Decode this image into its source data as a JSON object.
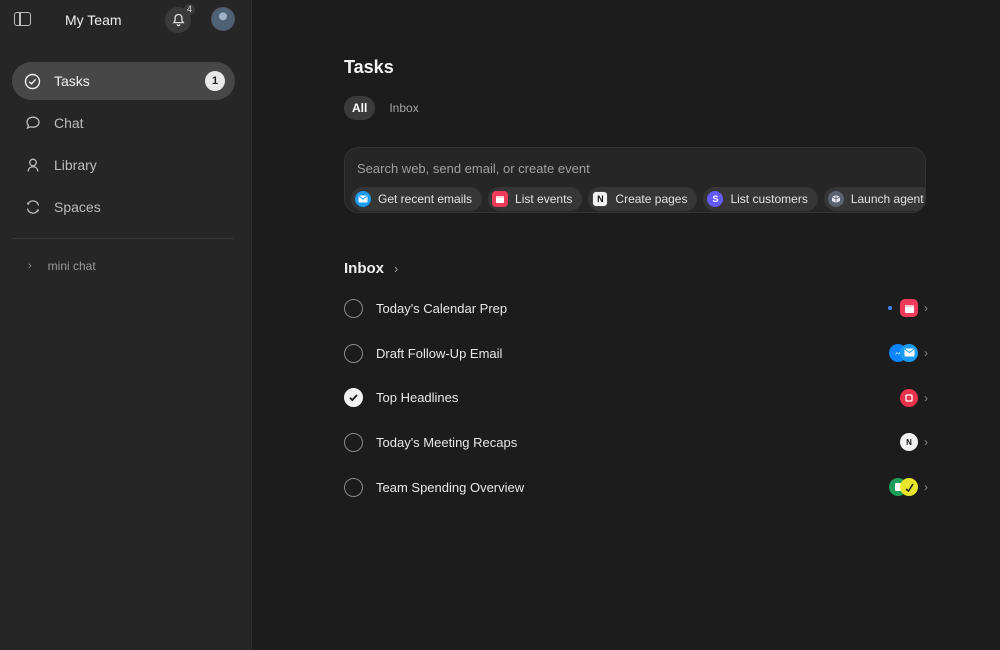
{
  "sidebar": {
    "team_name": "My Team",
    "notifications": "4",
    "nav": [
      {
        "label": "Tasks",
        "icon": "check-circle-icon",
        "count": "1",
        "active": true
      },
      {
        "label": "Chat",
        "icon": "chat-bubble-icon"
      },
      {
        "label": "Library",
        "icon": "person-icon"
      },
      {
        "label": "Spaces",
        "icon": "spaces-icon"
      }
    ],
    "sub_item": "mini chat"
  },
  "main": {
    "title": "Tasks",
    "tabs": [
      {
        "label": "All",
        "active": true
      },
      {
        "label": "Inbox"
      }
    ],
    "search": {
      "placeholder": "Search web, send email, or create event"
    },
    "chips": [
      {
        "label": "Get recent emails",
        "icon": "mail-icon",
        "color": "#1a9bf0"
      },
      {
        "label": "List events",
        "icon": "calendar-icon",
        "color": "#ef3b5b"
      },
      {
        "label": "Create pages",
        "icon": "notion-icon",
        "color": "#f2f2f2"
      },
      {
        "label": "List customers",
        "icon": "stripe-icon",
        "color": "#635bff"
      },
      {
        "label": "Launch agent",
        "icon": "agent-icon",
        "color": "#5b6270"
      }
    ],
    "inbox_title": "Inbox",
    "tasks": [
      {
        "title": "Today's Calendar Prep",
        "done": false
      },
      {
        "title": "Draft Follow-Up Email",
        "done": false
      },
      {
        "title": "Top Headlines",
        "done": true
      },
      {
        "title": "Today's Meeting Recaps",
        "done": false
      },
      {
        "title": "Team Spending Overview",
        "done": false
      }
    ]
  }
}
